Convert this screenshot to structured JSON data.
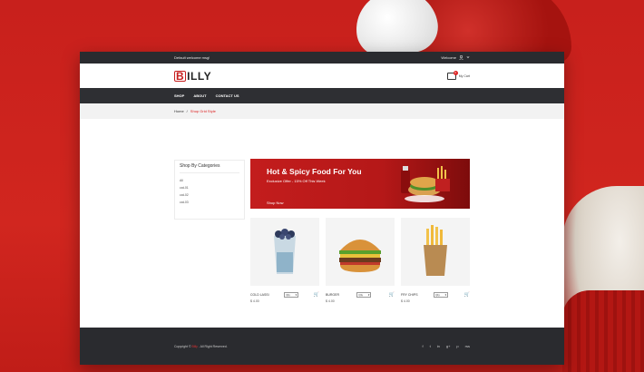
{
  "topbar": {
    "welcome_msg": "Default welcome msg!",
    "account_label": "Welcome"
  },
  "header": {
    "logo_initial": "B",
    "logo_rest": "ILLY",
    "cart_label": "My Cart",
    "cart_count": "0"
  },
  "nav": {
    "items": [
      "SHOP",
      "ABOUT",
      "CONTACT US"
    ]
  },
  "breadcrumb": {
    "home": "Home",
    "sep": "/",
    "current": "Shop Grid Style"
  },
  "sidebar": {
    "title": "Shop By Categories",
    "items": [
      "All",
      "cat-01",
      "cat-02",
      "cat-03"
    ]
  },
  "banner": {
    "title": "Hot & Spicy Food For You",
    "subtitle": "Exclusive Offer - 15% Off This Week",
    "cta": "Shop Now"
  },
  "products": [
    {
      "name": "COLD LASSI",
      "qty": "Qty",
      "price": "$ 4.00"
    },
    {
      "name": "BURGER",
      "qty": "Qty",
      "price": "$ 4.00"
    },
    {
      "name": "FRY CHIPS",
      "qty": "Qty",
      "price": "$ 4.00"
    }
  ],
  "footer": {
    "copyright_prefix": "Copyright ©",
    "brand": "Billy",
    "copyright_suffix": ". All Right Reserved.",
    "social": [
      "f",
      "t",
      "in",
      "g+",
      "p",
      "rss"
    ]
  },
  "colors": {
    "accent": "#c71f1f",
    "dark": "#2a2b2f"
  }
}
